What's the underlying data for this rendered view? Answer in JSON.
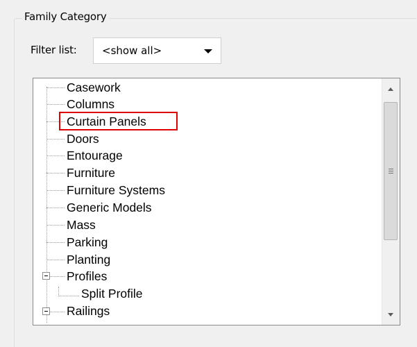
{
  "group": {
    "title": "Family Category"
  },
  "filter": {
    "label": "Filter list:",
    "value": "<show all>"
  },
  "tree": {
    "items": [
      {
        "label": "Casework"
      },
      {
        "label": "Columns"
      },
      {
        "label": "Curtain Panels",
        "highlighted": true
      },
      {
        "label": "Doors"
      },
      {
        "label": "Entourage"
      },
      {
        "label": "Furniture"
      },
      {
        "label": "Furniture Systems"
      },
      {
        "label": "Generic Models"
      },
      {
        "label": "Mass"
      },
      {
        "label": "Parking"
      },
      {
        "label": "Planting"
      },
      {
        "label": "Profiles",
        "expanded": true
      },
      {
        "label": "Split Profile",
        "child": true
      },
      {
        "label": "Railings",
        "expanded": true
      }
    ]
  },
  "colors": {
    "highlight_border": "#e00000",
    "background": "#f0f0f0"
  }
}
